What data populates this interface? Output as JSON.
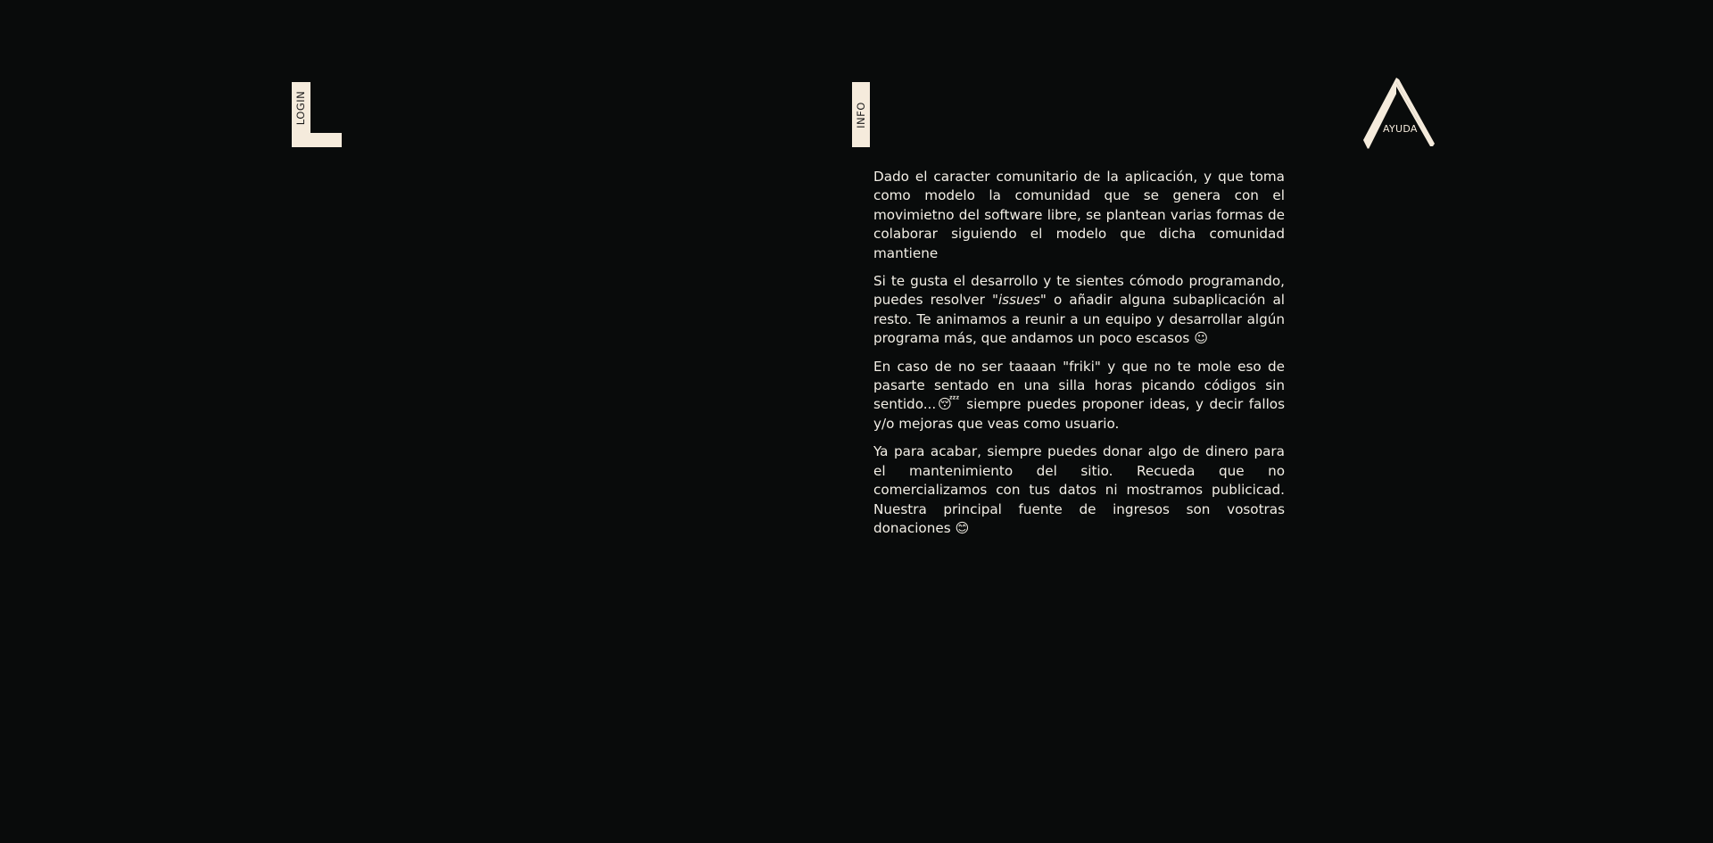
{
  "nav": {
    "login_label": "LOGIN",
    "info_label": "INFO",
    "ayuda_label": "AYUDA"
  },
  "colors": {
    "background": "#090b0b",
    "accent": "#f5ebdc",
    "text": "#f3efe6"
  },
  "info": {
    "p1": "Dado el caracter comunitario de la aplicación, y que toma como modelo la comunidad que se genera con el movimietno del software libre, se plantean varias formas de colaborar siguiendo el modelo que dicha comunidad mantiene",
    "p2_before": "Si te gusta el desarrollo y te sientes cómodo programando, puedes resolver \"",
    "p2_issues": "issues",
    "p2_after": "\" o añadir alguna subaplicación al resto. Te animamos a reunir a un equipo y desarrollar algún programa más, que andamos un poco escasos ☺",
    "p3": "En caso de no ser taaaan \"friki\" y que no te mole eso de pasarte sentado en una silla horas picando códigos sin sentido...😴 siempre puedes proponer ideas, y decir fallos y/o mejoras que veas como usuario.",
    "p4": "Ya para acabar, siempre puedes donar algo de dinero para el mantenimiento del sitio. Recueda que no comercializamos con tus datos ni mostramos publicicad. Nuestra principal fuente de ingresos son vosotras donaciones 😊"
  }
}
